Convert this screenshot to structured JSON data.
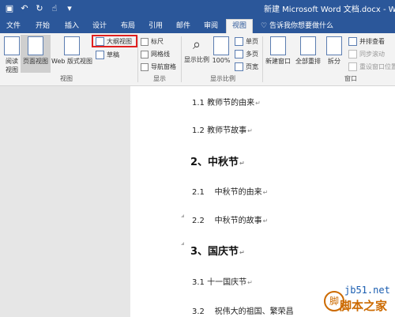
{
  "window": {
    "title": "新建 Microsoft Word 文档.docx - Word",
    "qat_icons": [
      "save-icon",
      "undo-icon",
      "redo-icon",
      "touch-mode-icon",
      "customize-icon"
    ]
  },
  "tabs": [
    {
      "label": "文件"
    },
    {
      "label": "开始"
    },
    {
      "label": "插入"
    },
    {
      "label": "设计"
    },
    {
      "label": "布局"
    },
    {
      "label": "引用"
    },
    {
      "label": "邮件"
    },
    {
      "label": "审阅"
    },
    {
      "label": "视图"
    }
  ],
  "tell_me": "告诉我你想要做什么",
  "ribbon": {
    "views": {
      "read_mode": "阅读\n视图",
      "print_layout": "页面视图",
      "web_layout": "Web 版式视图",
      "outline": "大纲视图",
      "draft": "草稿",
      "group": "视图"
    },
    "show": {
      "ruler": "标尺",
      "gridlines": "网格线",
      "nav_pane": "导航窗格",
      "group": "显示"
    },
    "zoom": {
      "zoom": "显示比例",
      "hundred": "100%",
      "one_page": "单页",
      "multi_page": "多页",
      "page_width": "页宽",
      "group": "显示比例"
    },
    "window": {
      "new_window": "新建窗口",
      "arrange_all": "全部重排",
      "split": "拆分",
      "side_by_side": "并排查看",
      "sync_scroll": "同步滚动",
      "reset_position": "重设窗口位置",
      "group": "窗口"
    }
  },
  "document": {
    "lines": [
      {
        "text": "1.1 教师节的由来"
      },
      {
        "text": "1.2 教师节故事"
      },
      {
        "text": "2、中秋节"
      },
      {
        "text": "2.1    中秋节的由来"
      },
      {
        "text": "2.2    中秋节的故事"
      },
      {
        "text": "3、国庆节"
      },
      {
        "text": "3.1 十一国庆节"
      },
      {
        "text": "3.2    祝伟大的祖国、繁荣昌"
      }
    ],
    "return_mark": "↵"
  },
  "watermark": {
    "site": "jb51.net",
    "brand": "脚本之家"
  }
}
